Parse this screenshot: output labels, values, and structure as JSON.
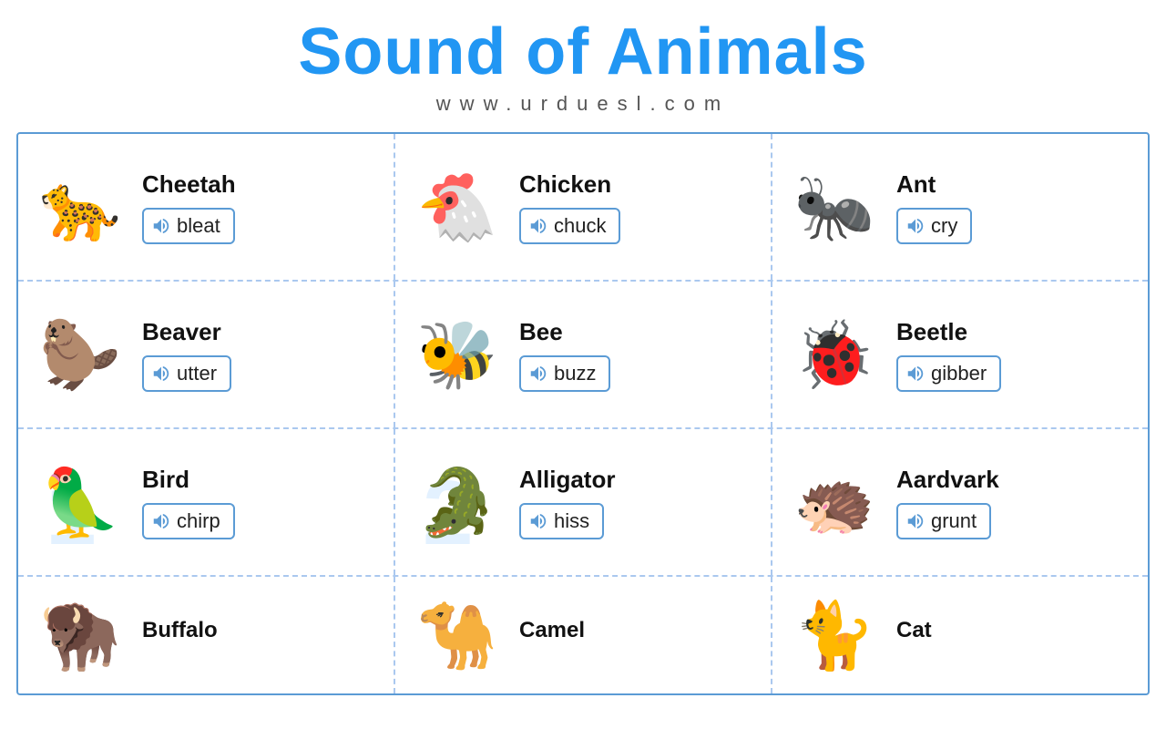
{
  "header": {
    "title": "Sound of Animals",
    "subtitle": "www.urduesl.com"
  },
  "grid": {
    "rows": [
      {
        "cells": [
          {
            "name": "Cheetah",
            "sound": "bleat",
            "emoji": "🐆"
          },
          {
            "name": "Chicken",
            "sound": "chuck",
            "emoji": "🐔"
          },
          {
            "name": "Ant",
            "sound": "cry",
            "emoji": "🐜"
          }
        ]
      },
      {
        "cells": [
          {
            "name": "Beaver",
            "sound": "utter",
            "emoji": "🦫"
          },
          {
            "name": "Bee",
            "sound": "buzz",
            "emoji": "🐝"
          },
          {
            "name": "Beetle",
            "sound": "gibber",
            "emoji": "🐞"
          }
        ]
      },
      {
        "cells": [
          {
            "name": "Bird",
            "sound": "chirp",
            "emoji": "🦜",
            "watermark": "1"
          },
          {
            "name": "Alligator",
            "sound": "hiss",
            "emoji": "🐊",
            "watermark": "2"
          },
          {
            "name": "Aardvark",
            "sound": "grunt",
            "emoji": "🦔"
          }
        ]
      },
      {
        "cells": [
          {
            "name": "Buffalo",
            "sound": "",
            "emoji": "🦬"
          },
          {
            "name": "Camel",
            "sound": "",
            "emoji": "🐪"
          },
          {
            "name": "Cat",
            "sound": "",
            "emoji": "🐈"
          }
        ],
        "partial": true
      }
    ]
  }
}
